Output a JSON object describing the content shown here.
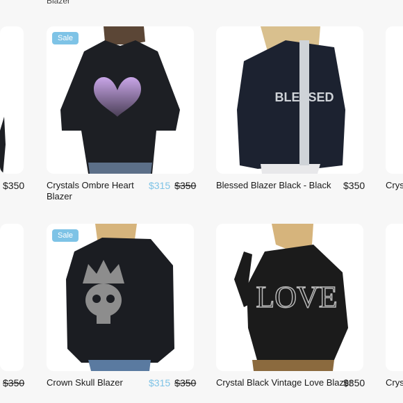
{
  "top_cut_text": "Blazer",
  "row1": {
    "left_partial_price": "$350",
    "products": [
      {
        "title": "Crystals Ombre Heart Blazer",
        "badge": "Sale",
        "sale_price": "$315",
        "original_price": "$350"
      },
      {
        "title": "Blessed Blazer Black - Black",
        "price": "$350",
        "graphic_text": "BLESSED"
      }
    ],
    "right_partial_title": "Cryst"
  },
  "row2": {
    "left_partial_price": "$350",
    "products": [
      {
        "title": "Crown Skull Blazer",
        "badge": "Sale",
        "sale_price": "$315",
        "original_price": "$350"
      },
      {
        "title": "Crystal Black Vintage Love Blazer",
        "price": "$350",
        "graphic_text": "LOVE"
      }
    ],
    "right_partial_title": "Cryst"
  },
  "colors": {
    "badge": "#7ec3e6",
    "sale_price": "#7ec3e6",
    "card_bg": "#ffffff",
    "page_bg": "#f7f7f7"
  }
}
